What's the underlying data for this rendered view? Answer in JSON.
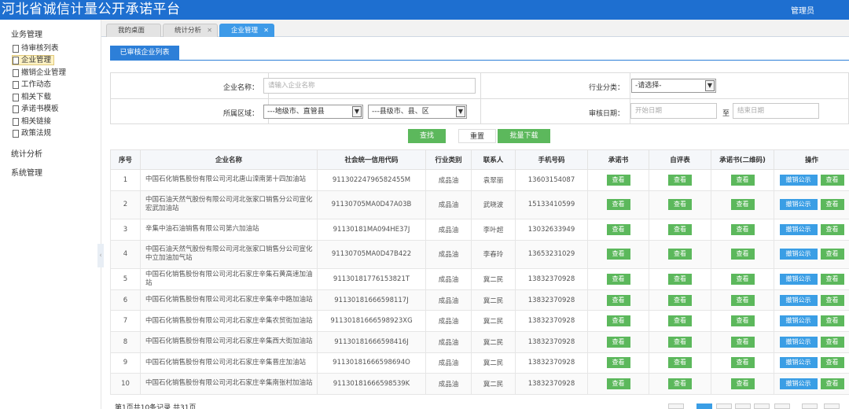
{
  "app": {
    "title": "河北省诚信计量公开承诺平台",
    "user": "管理员"
  },
  "sidebar": {
    "groups": [
      "业务管理",
      "统计分析",
      "系统管理"
    ],
    "items": [
      "待审核列表",
      "企业管理",
      "撤销企业管理",
      "工作动态",
      "相关下载",
      "承诺书模板",
      "相关链接",
      "政策法规"
    ],
    "active_index": 1
  },
  "tabs": [
    {
      "label": "我的桌面",
      "closable": false,
      "active": false
    },
    {
      "label": "统计分析",
      "closable": true,
      "active": false
    },
    {
      "label": "企业管理",
      "closable": true,
      "active": true
    }
  ],
  "section_title": "已审核企业列表",
  "filter": {
    "company_label": "企业名称：",
    "company_placeholder": "请输入企业名称",
    "industry_label": "行业分类：",
    "industry_value": "-请选择-",
    "region_label": "所属区域：",
    "city_value": "---地级市、直管县",
    "county_value": "---县级市、县、区",
    "date_label": "审核日期：",
    "date_start_placeholder": "开始日期",
    "date_to": "至",
    "date_end_placeholder": "结束日期",
    "search_btn": "查找",
    "reset_btn": "重置",
    "batch_download_btn": "批量下载"
  },
  "table": {
    "headers": [
      "序号",
      "企业名称",
      "社会统一信用代码",
      "行业类别",
      "联系人",
      "手机号码",
      "承诺书",
      "自评表",
      "承诺书(二维码)",
      "操作"
    ],
    "view_label": "查看",
    "revoke_label": "撤销公示",
    "rows": [
      {
        "no": "1",
        "name": "中国石化销售股份有限公司河北唐山滦南第十四加油站",
        "code": "91130224796582455M",
        "industry": "成品油",
        "contact": "袁翠丽",
        "phone": "13603154087"
      },
      {
        "no": "2",
        "name": "中国石油天然气股份有限公司河北张家口销售分公司宣化宏武加油站",
        "code": "91130705MA0D47A03B",
        "industry": "成品油",
        "contact": "武晓波",
        "phone": "15133410599"
      },
      {
        "no": "3",
        "name": "辛集中油石油销售有限公司第六加油站",
        "code": "91130181MA094HE37J",
        "industry": "成品油",
        "contact": "李叶超",
        "phone": "13032633949"
      },
      {
        "no": "4",
        "name": "中国石油天然气股份有限公司河北张家口销售分公司宣化中立加油加气站",
        "code": "91130705MA0D47B422",
        "industry": "成品油",
        "contact": "李春玲",
        "phone": "13653231029"
      },
      {
        "no": "5",
        "name": "中国石化销售股份有限公司河北石家庄辛集石黄高速加油站",
        "code": "91130181776153821T",
        "industry": "成品油",
        "contact": "冀二民",
        "phone": "13832370928"
      },
      {
        "no": "6",
        "name": "中国石化销售股份有限公司河北石家庄辛集辛中路加油站",
        "code": "91130181666598117J",
        "industry": "成品油",
        "contact": "冀二民",
        "phone": "13832370928"
      },
      {
        "no": "7",
        "name": "中国石化销售股份有限公司河北石家庄辛集农贸街加油站",
        "code": "91130181666598923XG",
        "industry": "成品油",
        "contact": "冀二民",
        "phone": "13832370928"
      },
      {
        "no": "8",
        "name": "中国石化销售股份有限公司河北石家庄辛集西大街加油站",
        "code": "91130181666598416J",
        "industry": "成品油",
        "contact": "冀二民",
        "phone": "13832370928"
      },
      {
        "no": "9",
        "name": "中国石化销售股份有限公司河北石家庄辛集晋庄加油站",
        "code": "91130181666598694O",
        "industry": "成品油",
        "contact": "冀二民",
        "phone": "13832370928"
      },
      {
        "no": "10",
        "name": "中国石化销售股份有限公司河北石家庄辛集南张村加油站",
        "code": "91130181666598539K",
        "industry": "成品油",
        "contact": "冀二民",
        "phone": "13832370928"
      }
    ]
  },
  "pager": {
    "text": "第1页共10条记录 共31页"
  },
  "colors": {
    "topbar": "#1e6fd0",
    "accent": "#2d7fd8",
    "green": "#5cb85c",
    "blue_btn": "#3a9ee5"
  }
}
